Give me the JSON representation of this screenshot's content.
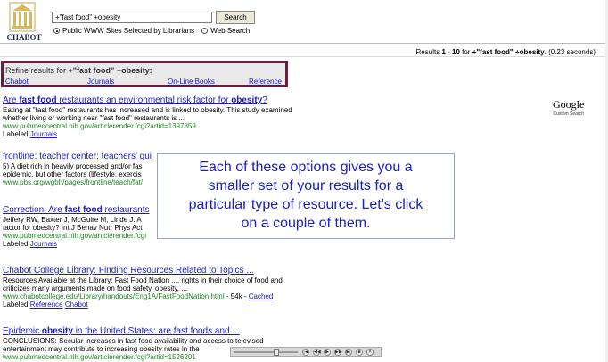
{
  "logo": {
    "wordmark": "CHABOT"
  },
  "search": {
    "query": "+\"fast food\" +obesity",
    "button_label": "Search"
  },
  "scope": {
    "options": [
      {
        "label": "Public WWW Sites Selected by Librarians",
        "selected": true
      },
      {
        "label": "Web Search",
        "selected": false
      }
    ]
  },
  "stats": {
    "prefix": "Results ",
    "range": "1 - 10",
    "mid": " for ",
    "query": "+\"fast food\" +obesity",
    "time": ". (0.23 seconds)"
  },
  "refine": {
    "label": "Refine results for ",
    "query": "+\"fast food\" +obesity:",
    "links": [
      "Chabot",
      "Journals",
      "On-Line Books",
      "Reference"
    ]
  },
  "google_logo": {
    "wordmark": "Google",
    "caption": "Custom Search"
  },
  "results": [
    {
      "title_a": "Are ",
      "title_b": "fast food",
      "title_c": " restaurants an environmental risk factor for ",
      "title_d": "obesity",
      "title_e": "?",
      "snippet1": "Eating at \"fast food\" restaurants has increased and is linked to obesity. This study examined",
      "snippet2": "whether living or working near \"fast food\" restaurants is ...",
      "url": "www.pubmedcentral.nih.gov/articlerender.fcgi?artid=1397859",
      "labeled": "Labeled ",
      "labels": [
        "Journals"
      ]
    },
    {
      "title": "frontline: teacher center: teachers' gui",
      "snippet1": "5) A diet rich in heavily processed and/or fas",
      "snippet2": "epidemic, but other factors (lifestyle, exercis",
      "url": "www.pbs.org/wgbh/pages/frontline/teach/fat/"
    },
    {
      "title_a": "Correction: Are ",
      "title_b": "fast food",
      "title_c": " restaurants",
      "snippet1": "Jeffery RW, Baxter J, McGuire M, Linde J. A",
      "snippet2": "factor for obesity? Int J Behav Nutr Phys Act",
      "url": "www.pubmedcentral.nih.gov/articlerender.fcgi",
      "labeled": "Labeled ",
      "labels": [
        "Journals"
      ]
    },
    {
      "title": "Chabot College Library: Finding Resources Related to Topics ...",
      "snippet1": "Resources Available at the Library: Fast Food Nation .... rights in their choice of food and",
      "snippet2": "criticizes many arguments made on food safety, obesity, ...",
      "url": "www.chabotcollege.edu/Library/handouts/Eng1A/FastFoodNation.html",
      "size": " - 54k - ",
      "cached": "Cached",
      "labeled": "Labeled ",
      "labels": [
        "Reference",
        "Chabot"
      ]
    },
    {
      "title_a": "Epidemic ",
      "title_b": "obesity",
      "title_c": " in the United States: are fast foods and ...",
      "snippet1": "CONCLUSIONS: Secular increases in fast food availability and access to televised",
      "snippet2": "entertainment may contribute to increasing obesity rates in the",
      "url": "www.pubmedcentral.nih.gov/articlerender.fcgi?artid=1526201"
    }
  ],
  "overlay": {
    "line1": "Each of these options gives you a",
    "line2": "smaller set of your results for a",
    "line3": "particular type of resource.  Let's click",
    "line4": "on a couple of them."
  },
  "player": {
    "controls": [
      "|◀",
      "◀◀",
      "▶",
      "▶▶",
      "▶|",
      "■",
      "✕"
    ]
  }
}
